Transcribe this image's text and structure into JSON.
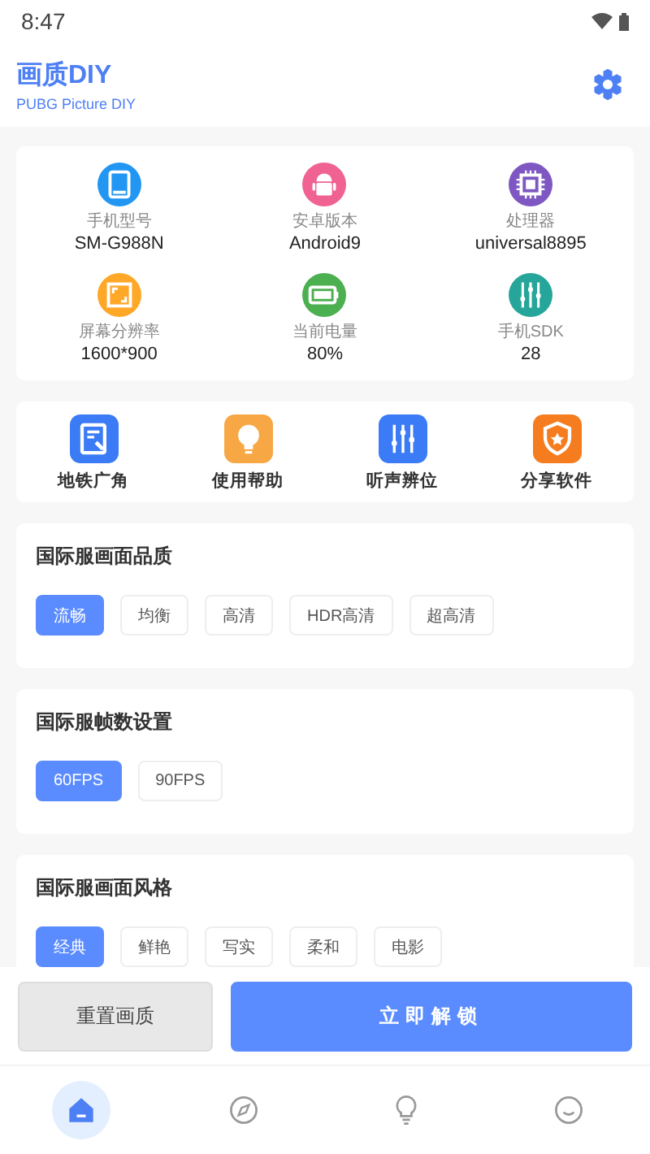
{
  "status_bar": {
    "time": "8:47"
  },
  "header": {
    "title": "画质DIY",
    "subtitle": "PUBG Picture DIY"
  },
  "device_info": [
    {
      "kind": "tablet",
      "color": "#2196f3",
      "label": "手机型号",
      "value": "SM-G988N"
    },
    {
      "kind": "android",
      "color": "#f06292",
      "label": "安卓版本",
      "value": "Android9"
    },
    {
      "kind": "chip",
      "color": "#7e57c2",
      "label": "处理器",
      "value": "universal8895"
    },
    {
      "kind": "screen",
      "color": "#ffa726",
      "label": "屏幕分辨率",
      "value": "1600*900"
    },
    {
      "kind": "battery",
      "color": "#4caf50",
      "label": "当前电量",
      "value": "80%"
    },
    {
      "kind": "sliders",
      "color": "#26a69a",
      "label": "手机SDK",
      "value": "28"
    }
  ],
  "tools": [
    {
      "kind": "document",
      "color": "#3b7bf6",
      "label": "地铁广角"
    },
    {
      "kind": "bulb",
      "color": "#f7a845",
      "label": "使用帮助"
    },
    {
      "kind": "sliders",
      "color": "#3b7bf6",
      "label": "听声辨位"
    },
    {
      "kind": "shield",
      "color": "#f57c1f",
      "label": "分享软件"
    }
  ],
  "sections": [
    {
      "title": "国际服画面品质",
      "options": [
        {
          "label": "流畅",
          "selected": true
        },
        {
          "label": "均衡",
          "selected": false
        },
        {
          "label": "高清",
          "selected": false
        },
        {
          "label": "HDR高清",
          "selected": false
        },
        {
          "label": "超高清",
          "selected": false
        }
      ]
    },
    {
      "title": "国际服帧数设置",
      "options": [
        {
          "label": "60FPS",
          "selected": true
        },
        {
          "label": "90FPS",
          "selected": false
        }
      ]
    },
    {
      "title": "国际服画面风格",
      "options": [
        {
          "label": "经典",
          "selected": true
        },
        {
          "label": "鲜艳",
          "selected": false
        },
        {
          "label": "写实",
          "selected": false
        },
        {
          "label": "柔和",
          "selected": false
        },
        {
          "label": "电影",
          "selected": false
        }
      ]
    }
  ],
  "actions": {
    "reset": "重置画质",
    "unlock": "立即解锁"
  },
  "nav": [
    {
      "kind": "home",
      "selected": true
    },
    {
      "kind": "compass",
      "selected": false
    },
    {
      "kind": "bulb",
      "selected": false
    },
    {
      "kind": "circle",
      "selected": false
    }
  ]
}
